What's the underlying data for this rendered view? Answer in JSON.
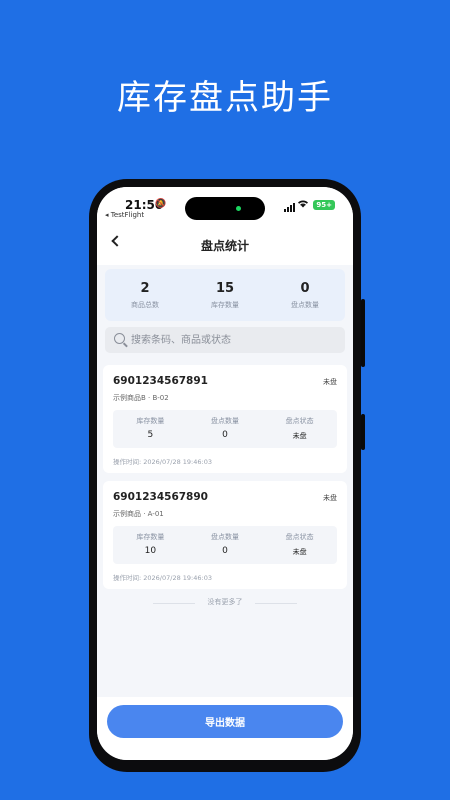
{
  "promo": {
    "title": "库存盘点助手"
  },
  "status_bar": {
    "time": "21:50",
    "bell": "🔕",
    "back_app": "◂ TestFlight",
    "wifi": "📶",
    "battery": "95+"
  },
  "nav": {
    "title": "盘点统计"
  },
  "stats": [
    {
      "value": "2",
      "label": "商品总数"
    },
    {
      "value": "15",
      "label": "库存数量"
    },
    {
      "value": "0",
      "label": "盘点数量"
    }
  ],
  "search": {
    "placeholder": "搜索条码、商品或状态",
    "value": ""
  },
  "items": [
    {
      "code": "6901234567891",
      "status": "未盘",
      "name": "示例商品B · B-02",
      "metrics": [
        {
          "label": "库存数量",
          "value": "5"
        },
        {
          "label": "盘点数量",
          "value": "0"
        },
        {
          "label": "盘点状态",
          "value": "未盘"
        }
      ],
      "time": "操作时间: 2026/07/28 19:46:03"
    },
    {
      "code": "6901234567890",
      "status": "未盘",
      "name": "示例商品 · A-01",
      "metrics": [
        {
          "label": "库存数量",
          "value": "10"
        },
        {
          "label": "盘点数量",
          "value": "0"
        },
        {
          "label": "盘点状态",
          "value": "未盘"
        }
      ],
      "time": "操作时间: 2026/07/28 19:46:03"
    }
  ],
  "footer": {
    "no_more": "没有更多了",
    "export_label": "导出数据"
  }
}
